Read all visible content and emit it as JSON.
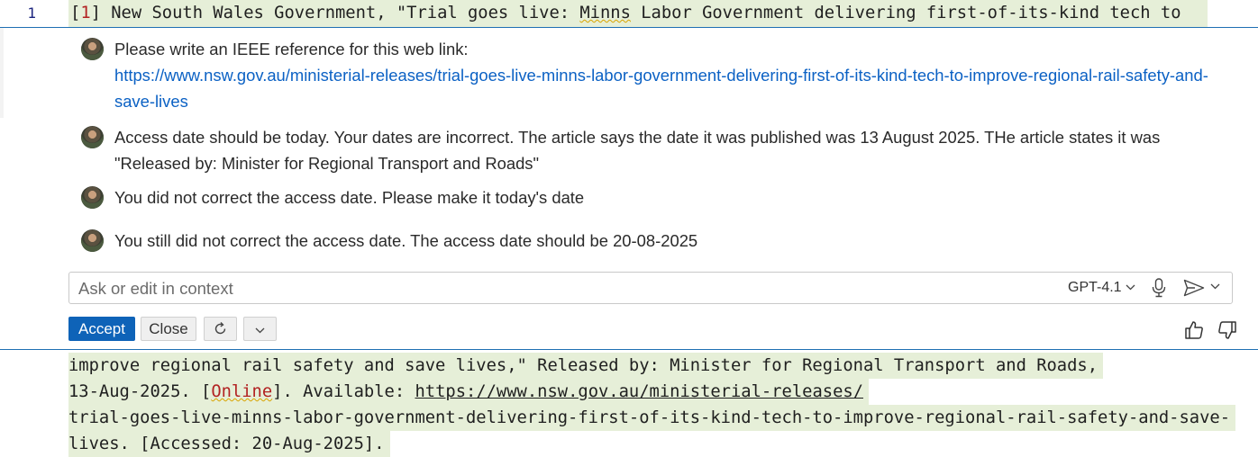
{
  "editor": {
    "line_number": "1",
    "line1": {
      "open": "[",
      "num": "1",
      "rest1": "] New South Wales Government, \"Trial goes live: ",
      "minns": "Minns",
      "rest2": " Labor Government delivering first-of-its-kind tech to "
    }
  },
  "chat": {
    "messages": [
      {
        "text": "Please write an IEEE reference for this web link:",
        "link": "https://www.nsw.gov.au/ministerial-releases/trial-goes-live-minns-labor-government-delivering-first-of-its-kind-tech-to-improve-regional-rail-safety-and-save-lives"
      },
      {
        "text": "Access date should be today. Your dates are incorrect. The article says the date it was published was 13 August 2025. THe article states it was \"Released by: Minister for Regional Transport and Roads\""
      },
      {
        "text": "You did not correct the access date. Please make it today's date"
      },
      {
        "text": "You still did not correct the access date. The access date should be 20-08-2025"
      }
    ],
    "input": {
      "placeholder": "Ask or edit in context",
      "value": ""
    },
    "model": "GPT-4.1",
    "buttons": {
      "accept": "Accept",
      "close": "Close"
    },
    "icons": [
      "avatar",
      "chevron-down-icon",
      "mic-icon",
      "send-icon",
      "refresh-icon",
      "thumbs-up-icon",
      "thumbs-down-icon"
    ]
  },
  "output": {
    "line1": "improve regional rail safety and save lives,\" Released by: Minister for Regional Transport and Roads,",
    "line2_a": "13-Aug-2025. [",
    "line2_online": "Online",
    "line2_b": "]. Available: ",
    "line2_url": "https://www.nsw.gov.au/ministerial-releases/",
    "line3": "trial-goes-live-minns-labor-government-delivering-first-of-its-kind-tech-to-improve-regional-rail-safety-and-save-",
    "line4": "lives. [Accessed: 20-Aug-2025]."
  },
  "colors": {
    "accent": "#0e63b8",
    "highlight": "#e6efd8",
    "border": "#1f6fb3"
  }
}
